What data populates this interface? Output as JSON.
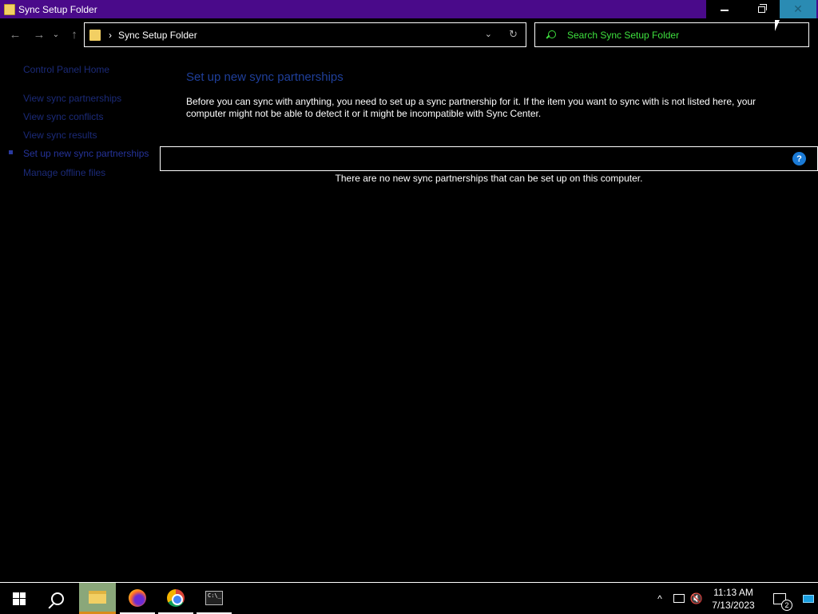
{
  "window": {
    "title": "Sync Setup Folder",
    "close_glyph": "✕"
  },
  "navigation": {
    "back_glyph": "←",
    "forward_glyph": "→",
    "recent_glyph": "⌄",
    "up_glyph": "↑",
    "breadcrumb_sep": "›",
    "address_path": "Sync Setup Folder",
    "dropdown_glyph": "⌄",
    "refresh_glyph": "↻",
    "search_placeholder": "Search Sync Setup Folder"
  },
  "sidebar": {
    "home": "Control Panel Home",
    "items": [
      {
        "label": "View sync partnerships"
      },
      {
        "label": "View sync conflicts"
      },
      {
        "label": "View sync results"
      },
      {
        "label": "Set up new sync partnerships",
        "active": true
      },
      {
        "label": "Manage offline files"
      }
    ]
  },
  "main": {
    "heading": "Set up new sync partnerships",
    "description": "Before you can sync with anything, you need to set up a sync partnership for it. If the item you want to sync with is not listed here, your computer might not be able to detect it or it might be incompatible with Sync Center.",
    "help_glyph": "?",
    "empty_message": "There are no new sync partnerships that can be set up on this computer."
  },
  "taskbar": {
    "terminal_glyph": "C:\\_",
    "tray_up_glyph": "^",
    "volume_glyph": "🔇",
    "time": "11:13 AM",
    "date": "7/13/2023",
    "notification_count": "2"
  },
  "colors": {
    "title_bar": "#4a0a8a",
    "close_button": "#2a8bb3",
    "link": "#1b2a78",
    "heading": "#1f3f9a",
    "search_text": "#3ee03e"
  }
}
